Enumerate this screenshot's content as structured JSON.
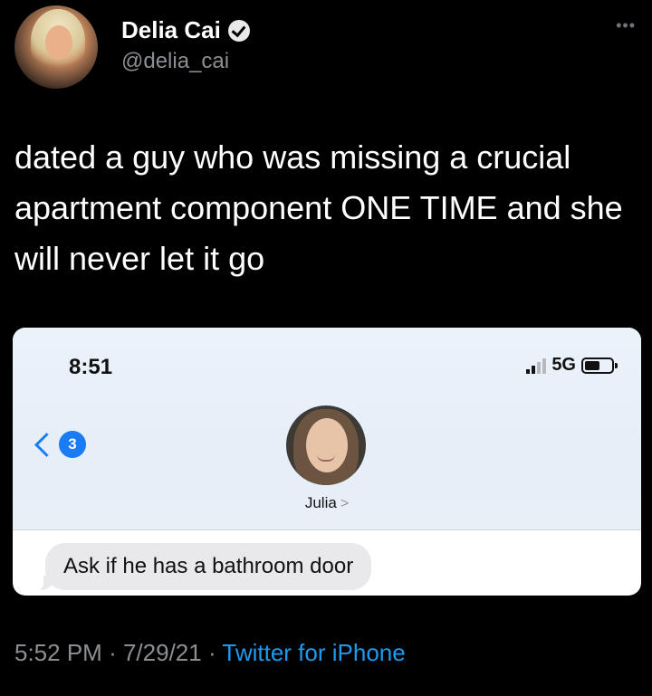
{
  "tweet": {
    "display_name": "Delia Cai",
    "handle": "@delia_cai",
    "verified_icon": "verified-badge-icon",
    "more_label": "•••",
    "text": "dated a guy who was missing a crucial apartment component ONE TIME and she will never let it go",
    "time": "5:52 PM",
    "separator": "·",
    "date": "7/29/21",
    "source": "Twitter for iPhone"
  },
  "embedded_screenshot": {
    "status_time": "8:51",
    "network": "5G",
    "back_count": "3",
    "contact_name": "Julia",
    "contact_arrow": ">",
    "message": "Ask if he has a bathroom door"
  },
  "colors": {
    "background": "#000000",
    "link": "#1d9bf0",
    "ios_blue": "#1a7cf5",
    "bubble_gray": "#e9e9eb"
  }
}
